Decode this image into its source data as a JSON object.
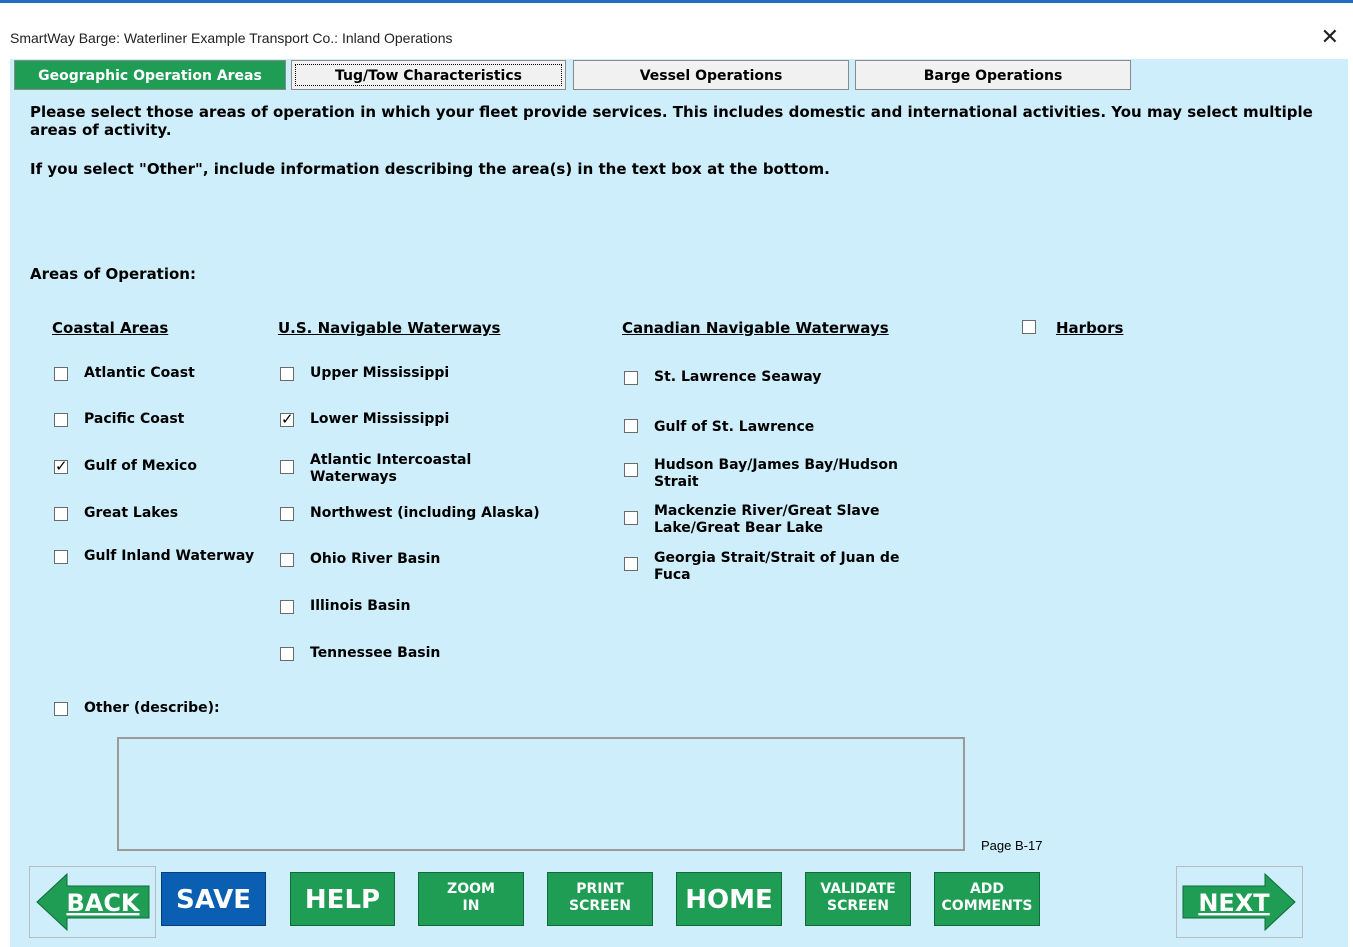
{
  "window": {
    "title": "SmartWay Barge: Waterliner Example Transport Co.: Inland Operations",
    "close_icon": "close-icon"
  },
  "tabs": [
    {
      "label": "Geographic Operation Areas",
      "mnemonic": "G"
    },
    {
      "label": "Tug/Tow Characteristics",
      "mnemonic": "T"
    },
    {
      "label": "Vessel Operations",
      "mnemonic": "O"
    },
    {
      "label": "Barge Operations",
      "mnemonic": "B"
    }
  ],
  "intro": {
    "text1": "Please select those areas of operation in which your fleet provide services. This includes domestic and international activities. You may select multiple areas of activity.",
    "text2": "If you select \"Other\", include information describing the area(s) in the text box at the bottom."
  },
  "areas_label": "Areas of Operation:",
  "columns": {
    "coastal": {
      "heading": "Coastal Areas",
      "items": [
        {
          "label": "Atlantic Coast",
          "checked": false
        },
        {
          "label": "Pacific Coast",
          "checked": false
        },
        {
          "label": "Gulf of Mexico",
          "checked": true
        },
        {
          "label": "Great Lakes",
          "checked": false
        },
        {
          "label": "Gulf Inland Waterway",
          "checked": false
        }
      ]
    },
    "us": {
      "heading": "U.S. Navigable Waterways",
      "items": [
        {
          "label": "Upper Mississippi",
          "checked": false
        },
        {
          "label": "Lower Mississippi",
          "checked": true
        },
        {
          "label": "Atlantic Intercoastal Waterways",
          "checked": false
        },
        {
          "label": "Northwest (including Alaska)",
          "checked": false
        },
        {
          "label": "Ohio River Basin",
          "checked": false
        },
        {
          "label": "Illinois Basin",
          "checked": false
        },
        {
          "label": "Tennessee Basin",
          "checked": false
        }
      ]
    },
    "canada": {
      "heading": "Canadian Navigable Waterways",
      "items": [
        {
          "label": "St. Lawrence Seaway",
          "checked": false
        },
        {
          "label": "Gulf of St. Lawrence",
          "checked": false
        },
        {
          "label": "Hudson Bay/James Bay/Hudson Strait",
          "checked": false
        },
        {
          "label": "Mackenzie River/Great Slave Lake/Great Bear Lake",
          "checked": false
        },
        {
          "label": "Georgia Strait/Strait of Juan de Fuca",
          "checked": false
        }
      ]
    },
    "harbors": {
      "label": "Harbors",
      "checked": false
    }
  },
  "other": {
    "label": "Other (describe):",
    "checked": false,
    "value": ""
  },
  "buttons": {
    "back": "BACK",
    "save": "SAVE",
    "help": "HELP",
    "zoom_line1": "ZOOM",
    "zoom_line2": "IN",
    "print_line1": "PRINT",
    "print_line2": "SCREEN",
    "home": "HOME",
    "validate_line1": "VALIDATE",
    "validate_line2": "SCREEN",
    "comments_line1": "ADD",
    "comments_line2": "COMMENTS",
    "next": "NEXT"
  },
  "page_number": "Page B-17",
  "colors": {
    "panel_bg": "#cdeefa",
    "button_green": "#1f9d55",
    "save_blue": "#0a5fb3",
    "active_tab": "#1f9d55"
  }
}
